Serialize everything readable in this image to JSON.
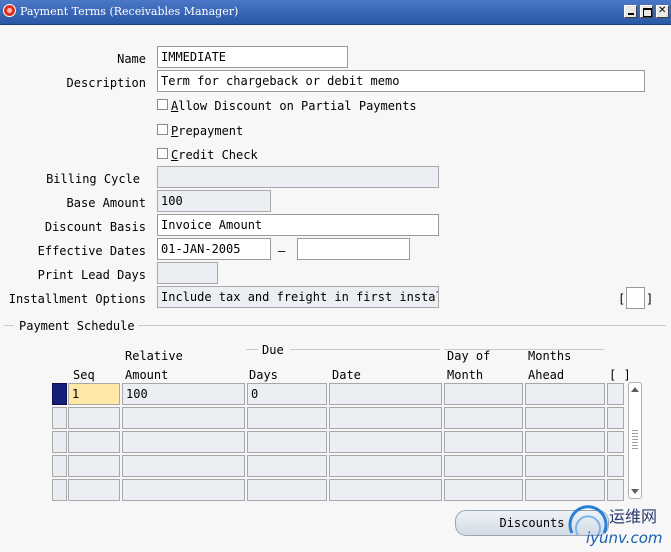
{
  "window": {
    "title": "Payment Terms (Receivables Manager)"
  },
  "form": {
    "name_label": "Name",
    "name_value": "IMMEDIATE",
    "description_label": "Description",
    "description_value": "Term for chargeback or debit memo",
    "allow_discount_label": "llow Discount on Partial Payments",
    "allow_discount_mnemonic": "A",
    "allow_discount_checked": false,
    "prepayment_label": "repayment",
    "prepayment_mnemonic": "P",
    "prepayment_checked": false,
    "credit_check_label": "redit Check",
    "credit_check_mnemonic": "C",
    "credit_check_checked": false,
    "billing_cycle_label": "Billing Cycle",
    "billing_cycle_value": "",
    "base_amount_label": "Base Amount",
    "base_amount_value": "100",
    "discount_basis_label": "Discount Basis",
    "discount_basis_value": "Invoice Amount",
    "effective_dates_label": "Effective Dates",
    "effective_from": "01-JAN-2005",
    "date_separator": "–",
    "effective_to": "",
    "print_lead_days_label": "Print Lead Days",
    "print_lead_days_value": "",
    "installment_options_label": "Installment Options",
    "installment_options_value": "Include tax and freight in first install",
    "flex_marker_left": "[",
    "flex_marker_right": "]"
  },
  "schedule": {
    "section_title": "Payment Schedule",
    "group_header_due": "Due",
    "columns": {
      "seq": "Seq",
      "relative_amount_line1": "Relative",
      "relative_amount_line2": "Amount",
      "days": "Days",
      "date": "Date",
      "day_of_month_line1": "Day of",
      "day_of_month_line2": "Month",
      "months_ahead_line1": "Months",
      "months_ahead_line2": "Ahead",
      "flex": "[ ]"
    },
    "rows": [
      {
        "seq": "1",
        "relative_amount": "100",
        "days": "0",
        "date": "",
        "day_of_month": "",
        "months_ahead": ""
      },
      {
        "seq": "",
        "relative_amount": "",
        "days": "",
        "date": "",
        "day_of_month": "",
        "months_ahead": ""
      },
      {
        "seq": "",
        "relative_amount": "",
        "days": "",
        "date": "",
        "day_of_month": "",
        "months_ahead": ""
      },
      {
        "seq": "",
        "relative_amount": "",
        "days": "",
        "date": "",
        "day_of_month": "",
        "months_ahead": ""
      },
      {
        "seq": "",
        "relative_amount": "",
        "days": "",
        "date": "",
        "day_of_month": "",
        "months_ahead": ""
      }
    ],
    "current_row": 0
  },
  "buttons": {
    "discounts_label": "Discounts"
  },
  "watermark": {
    "cn": "运维网",
    "url": "iyunv.com"
  },
  "colors": {
    "titlebar": "#2a56a6",
    "current_field": "#ffe8a6",
    "current_row_marker": "#16207a",
    "readonly_field": "#ebeff4"
  },
  "icons": [
    "app-icon",
    "minimize-icon",
    "maximize-icon",
    "close-icon",
    "scroll-up-icon",
    "scroll-down-icon"
  ]
}
